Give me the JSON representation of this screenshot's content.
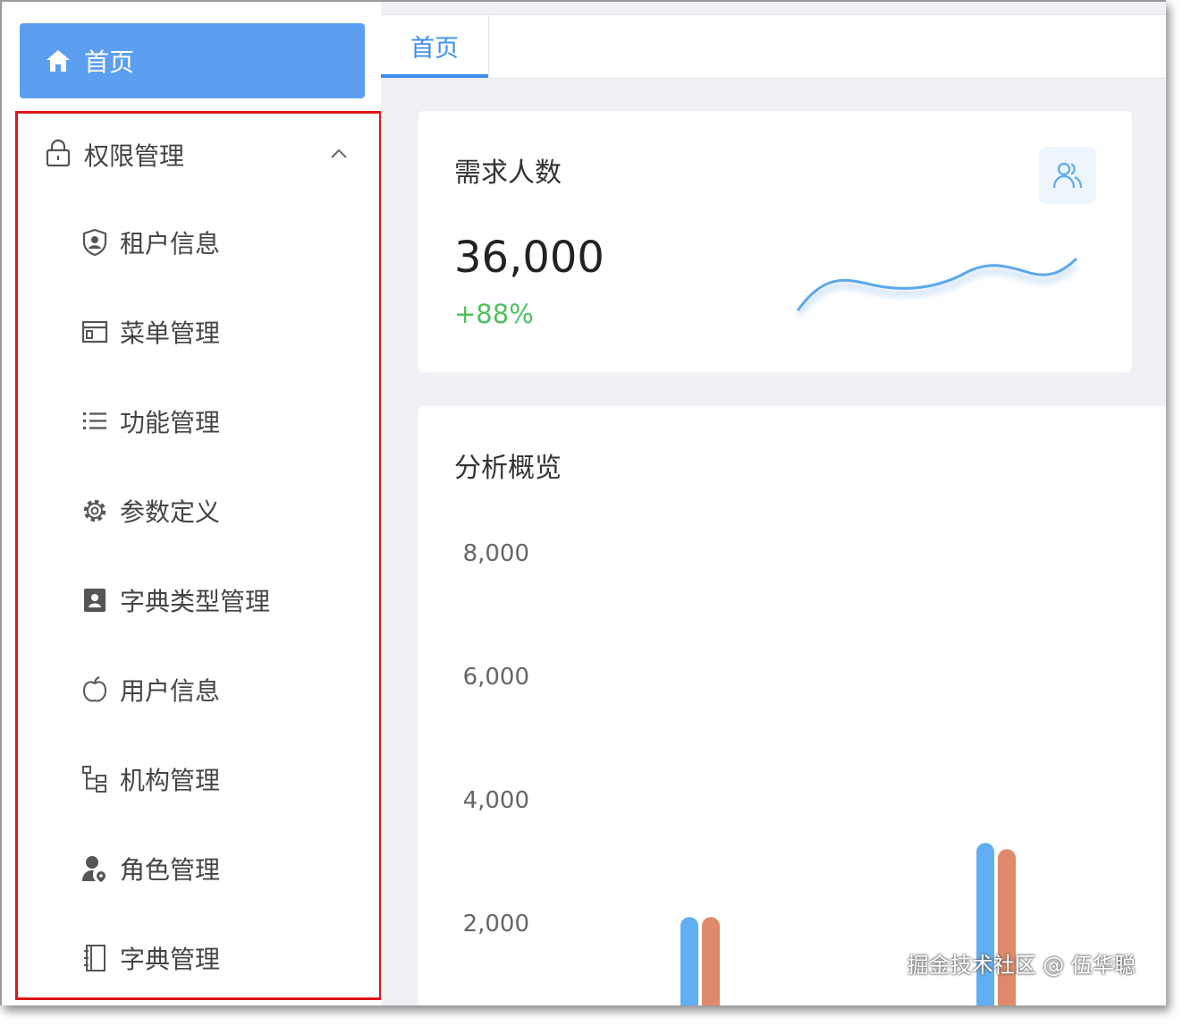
{
  "sidebar": {
    "home_label": "首页",
    "group_label": "权限管理",
    "items": [
      {
        "label": "租户信息",
        "icon": "shield-user-icon"
      },
      {
        "label": "菜单管理",
        "icon": "window-icon"
      },
      {
        "label": "功能管理",
        "icon": "list-icon"
      },
      {
        "label": "参数定义",
        "icon": "gear-icon"
      },
      {
        "label": "字典类型管理",
        "icon": "contact-card-icon"
      },
      {
        "label": "用户信息",
        "icon": "apple-icon"
      },
      {
        "label": "机构管理",
        "icon": "tree-icon"
      },
      {
        "label": "角色管理",
        "icon": "user-pin-icon"
      },
      {
        "label": "字典管理",
        "icon": "notebook-icon"
      }
    ]
  },
  "tabs": [
    {
      "label": "首页",
      "active": true
    }
  ],
  "stat_card": {
    "title": "需求人数",
    "value": "36,000",
    "delta": "+88%",
    "icon": "users-icon",
    "accent": "#5ba8ef",
    "delta_color": "#4fc060"
  },
  "chart_card": {
    "title": "分析概览"
  },
  "chart_data": {
    "type": "bar",
    "title": "分析概览",
    "ylim": [
      0,
      8000
    ],
    "yticks": [
      "8,000",
      "6,000",
      "4,000",
      "2,000"
    ],
    "series": [
      {
        "color": "#62aef2",
        "values": [
          2100,
          3300
        ]
      },
      {
        "color": "#e0896a",
        "values": [
          2100,
          3200
        ]
      }
    ],
    "grid": false
  },
  "watermark": "掘金技术社区 @ 伍华聪"
}
